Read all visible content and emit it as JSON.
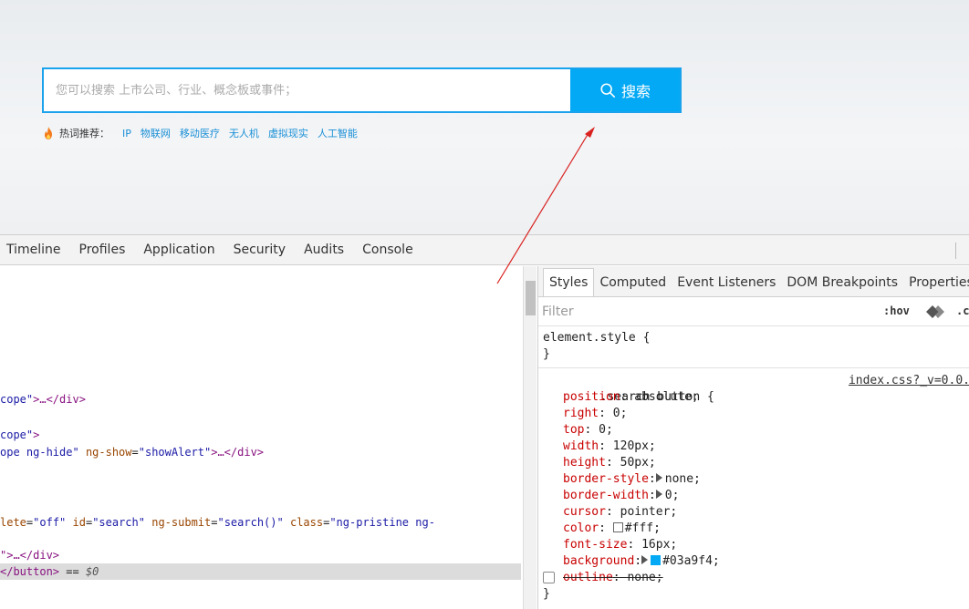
{
  "search": {
    "placeholder": "您可以搜索 上市公司、行业、概念板或事件；",
    "button_label": "搜索",
    "hot_label": "热词推荐：",
    "hot_words": [
      "IP",
      "物联网",
      "移动医疗",
      "无人机",
      "虚拟现实",
      "人工智能"
    ]
  },
  "devtools": {
    "tabs": [
      "Timeline",
      "Profiles",
      "Application",
      "Security",
      "Audits",
      "Console"
    ],
    "elements_lines": [
      {
        "pre": "",
        "attr1": "",
        "val1": "cope\">",
        "tag": "…</div>",
        "tail": ""
      },
      {
        "pre": "",
        "attr1": "",
        "val1": "cope\">",
        "tag": "",
        "tail": ""
      },
      {
        "pre": "",
        "attr1": "",
        "val1": "ope ng-hide\"",
        "tag": "",
        "tail": ""
      },
      {
        "pre": "",
        "attr1": "",
        "val1": "",
        "tag": "",
        "tail": ""
      },
      {
        "pre": "",
        "attr1": "",
        "val1": "",
        "tag": "",
        "tail": ""
      }
    ],
    "el": {
      "l1_val": "cope\"",
      "l1_rest": ">…</div>",
      "l2_val": "cope\"",
      "l2_rest": ">",
      "l3_val": "ope ng-hide\"",
      "l3_attr": "ng-show",
      "l3_eq": "=",
      "l3_val2": "\"showAlert\"",
      "l3_rest": ">…</div>",
      "l4_attr0": "lete",
      "l4_eq0": "=",
      "l4_val0": "\"off\"",
      "l4_attr1": "id",
      "l4_val1": "\"search\"",
      "l4_attr2": "ng-submit",
      "l4_val2": "\"search()\"",
      "l4_attr3": "class",
      "l4_val3": "\"ng-pristine ng-",
      "l5_text": "\">…</div>",
      "l6_tag": "</button>",
      "l6_eq": " == ",
      "l6_dollar": "$0"
    },
    "styles_tabs": [
      "Styles",
      "Computed",
      "Event Listeners",
      "DOM Breakpoints",
      "Properties"
    ],
    "filter_placeholder": "Filter",
    "hov": ":hov",
    "cls": ".c",
    "element_style_sel": "element.style {",
    "element_style_close": "}",
    "rule_selector": ".search button {",
    "rule_source": "index.css?_v=0.0.",
    "rule_close": "}",
    "props": [
      {
        "name": "position",
        "value": "absolute;"
      },
      {
        "name": "right",
        "value": "0;"
      },
      {
        "name": "top",
        "value": "0;"
      },
      {
        "name": "width",
        "value": "120px;"
      },
      {
        "name": "height",
        "value": "50px;"
      },
      {
        "name": "border-style",
        "value": "none;"
      },
      {
        "name": "border-width",
        "value": "0;"
      },
      {
        "name": "cursor",
        "value": "pointer;"
      },
      {
        "name": "color",
        "value": "#fff;"
      },
      {
        "name": "font-size",
        "value": "16px;"
      },
      {
        "name": "background",
        "value": "#03a9f4;"
      },
      {
        "name": "outline",
        "value": "none;"
      }
    ]
  },
  "colors": {
    "accent": "#03a9f4",
    "white": "#ffffff",
    "arrow": "#d9211f"
  }
}
